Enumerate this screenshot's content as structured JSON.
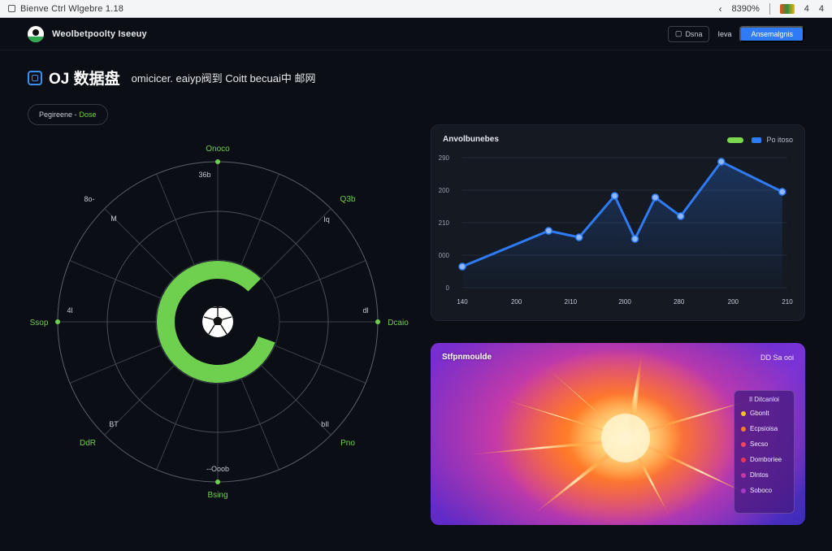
{
  "browser": {
    "tab_title": "Bienve Ctrl Wlgebre 1.18",
    "count": "8390%",
    "menu_a": "4",
    "menu_b": "4"
  },
  "header": {
    "brand": "Weolbetpoolty Iseeuy",
    "btn_outline": "Dsna",
    "btn_text": "Ieva",
    "btn_primary": "Ansemalgnis"
  },
  "page": {
    "title": "OJ 数据盘",
    "subtitle": "omicicer. eaiyp阀到 Coitt becuai中 邮网"
  },
  "filter_chip": {
    "label": "Pegireene -",
    "value": "Dose"
  },
  "radial": {
    "center_icon": "soccer-ball-icon",
    "progress_color": "#6fd04f",
    "progress_fraction": 0.82,
    "labels": {
      "top": "Onoco",
      "top_inner": "36b",
      "top_left": "8o-",
      "top_left_inner": "M",
      "top_right": "Q3b",
      "top_right_inner": "Iq",
      "left": "Ssop",
      "left_inner": "4l",
      "right": "Dcaio",
      "right_inner": "dl",
      "bottom_left": "DdR",
      "bottom_left_inner": "BT",
      "bottom_right": "Pno",
      "bottom_right_inner": "bIl",
      "bottom": "Bsing",
      "bottom_inner": "--Ooob"
    }
  },
  "line_card": {
    "title": "Anvolbunebes",
    "legend_label": "Po itoso"
  },
  "chart_data": {
    "type": "line",
    "title": "Anvolbunebes",
    "x_ticks": [
      "140",
      "200",
      "2I10",
      "2I00",
      "280",
      "200",
      "210"
    ],
    "y_ticks": [
      "0",
      "000",
      "210",
      "200",
      "290"
    ],
    "series": [
      {
        "values": [
          26,
          70,
          62,
          113,
          60,
          111,
          88,
          155,
          118
        ]
      }
    ],
    "x": [
      0,
      1.7,
      2.3,
      3.0,
      3.4,
      3.8,
      4.3,
      5.1,
      6.3
    ],
    "ylim": [
      0,
      160
    ],
    "xlim": [
      0,
      6.4
    ],
    "grid": true,
    "line_color": "#2f7bf5",
    "legend": "top-right"
  },
  "heat_card": {
    "title": "Stfpnmoulde",
    "tag": "DD Sa ooi",
    "legend_head": "Il Ditcanloi",
    "legend_items": [
      {
        "label": "Gbonlt",
        "color": "#f5c028"
      },
      {
        "label": "Ecpsioisa",
        "color": "#ff7a2a"
      },
      {
        "label": "Secso",
        "color": "#f0455f"
      },
      {
        "label": "Domboriee",
        "color": "#e5365a"
      },
      {
        "label": "Dlntos",
        "color": "#c53aa8"
      },
      {
        "label": "Soboco",
        "color": "#a53ac8"
      }
    ]
  }
}
